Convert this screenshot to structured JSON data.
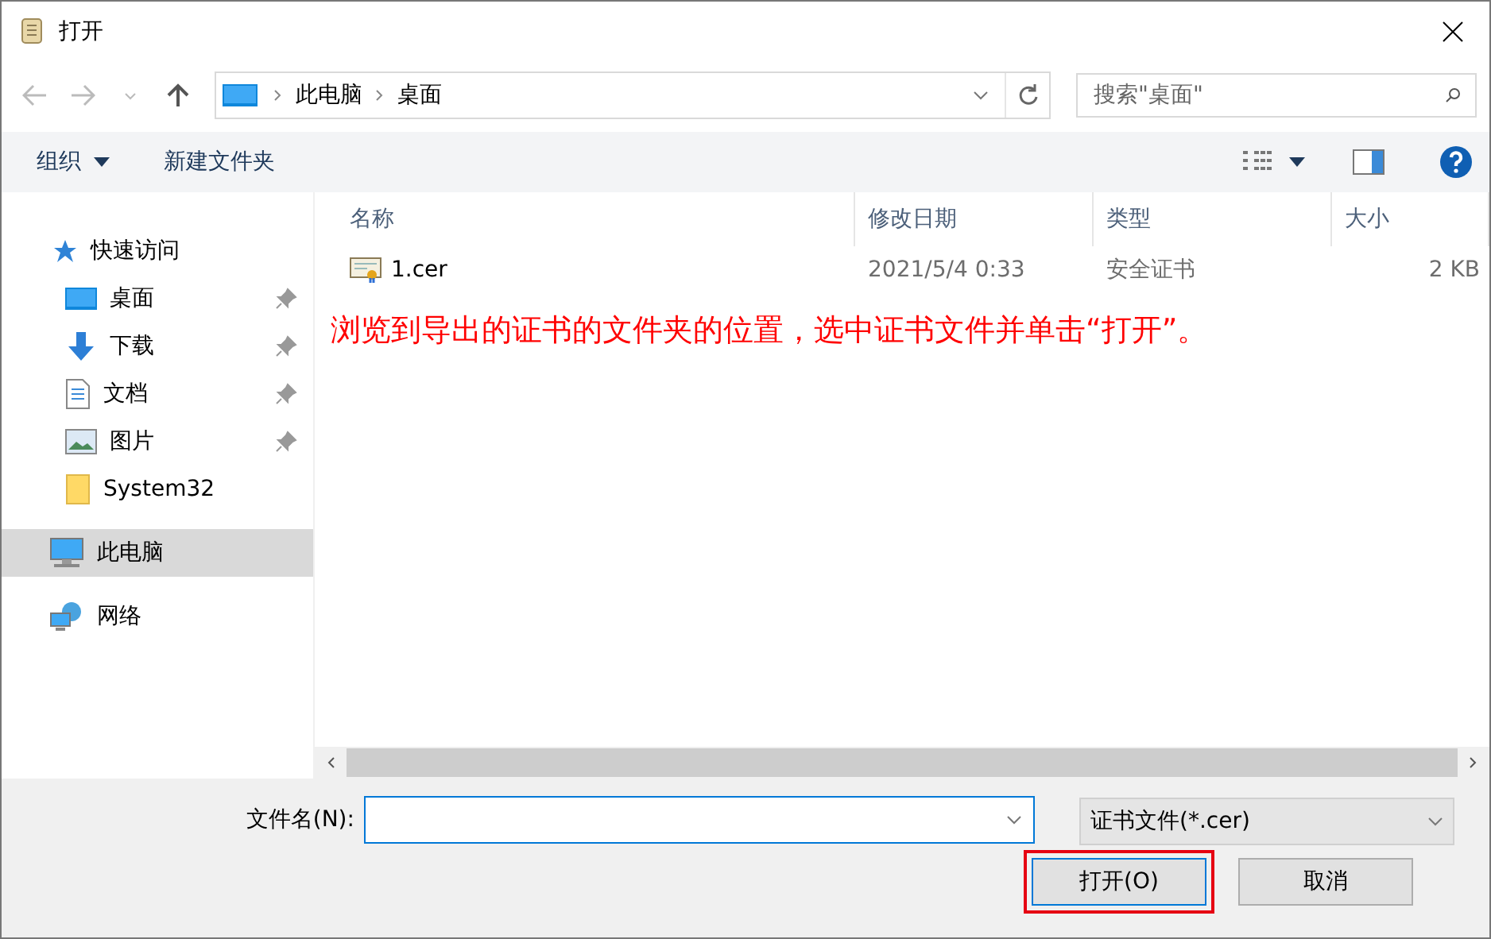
{
  "window": {
    "title": "打开"
  },
  "address": {
    "path": [
      {
        "label": "此电脑"
      },
      {
        "label": "桌面"
      }
    ]
  },
  "search": {
    "placeholder": "搜索\"桌面\""
  },
  "toolbar": {
    "organize": "组织",
    "new_folder": "新建文件夹"
  },
  "sidebar": {
    "items": [
      {
        "label": "快速访问",
        "kind": "star",
        "selected": false,
        "children": [
          {
            "label": "桌面",
            "kind": "desktop",
            "pinned": true,
            "selected": false
          },
          {
            "label": "下载",
            "kind": "download",
            "pinned": true,
            "selected": false
          },
          {
            "label": "文档",
            "kind": "document",
            "pinned": true,
            "selected": false
          },
          {
            "label": "图片",
            "kind": "picture",
            "pinned": true,
            "selected": false
          },
          {
            "label": "System32",
            "kind": "folder",
            "pinned": false,
            "selected": false
          }
        ]
      },
      {
        "label": "此电脑",
        "kind": "computer",
        "selected": true
      },
      {
        "label": "网络",
        "kind": "network",
        "selected": false
      }
    ]
  },
  "table": {
    "columns": [
      {
        "label": "名称"
      },
      {
        "label": "修改日期"
      },
      {
        "label": "类型"
      },
      {
        "label": "大小"
      }
    ],
    "rows": [
      {
        "name": "1.cer",
        "modified": "2021/5/4 0:33",
        "type": "安全证书",
        "size": "2 KB",
        "selected": false
      }
    ]
  },
  "annotation": "浏览到导出的证书的文件夹的位置，选中证书文件并单击“打开”。",
  "footer": {
    "filename_label": "文件名(N):",
    "filter": "证书文件(*.cer)",
    "buttons": [
      {
        "label": "打开(O)",
        "highlighted": true
      },
      {
        "label": "取消",
        "highlighted": false
      }
    ]
  }
}
